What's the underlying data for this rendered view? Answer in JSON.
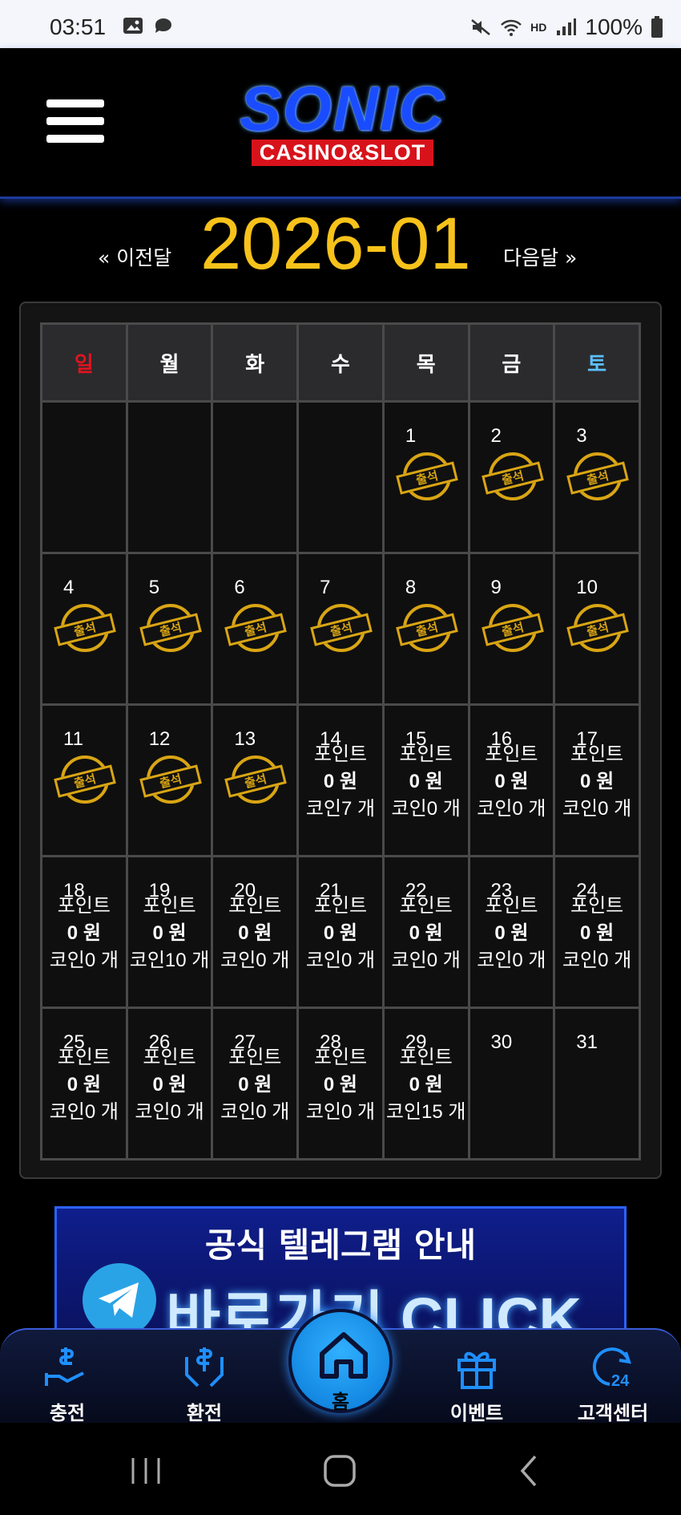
{
  "status_bar": {
    "time": "03:51",
    "battery": "100%",
    "hd_label": "HD"
  },
  "header": {
    "logo_main": "SONIC",
    "logo_sub": "CASINO&SLOT"
  },
  "month_nav": {
    "prev_label": "« 이전달",
    "title": "2026-01",
    "next_label": "다음달 »"
  },
  "weekdays": [
    "일",
    "월",
    "화",
    "수",
    "목",
    "금",
    "토"
  ],
  "stamp_text": "출석",
  "weeks": [
    [
      {
        "day": ""
      },
      {
        "day": ""
      },
      {
        "day": ""
      },
      {
        "day": ""
      },
      {
        "day": "1",
        "stamp": true
      },
      {
        "day": "2",
        "stamp": true
      },
      {
        "day": "3",
        "stamp": true
      }
    ],
    [
      {
        "day": "4",
        "stamp": true
      },
      {
        "day": "5",
        "stamp": true
      },
      {
        "day": "6",
        "stamp": true
      },
      {
        "day": "7",
        "stamp": true
      },
      {
        "day": "8",
        "stamp": true
      },
      {
        "day": "9",
        "stamp": true
      },
      {
        "day": "10",
        "stamp": true
      }
    ],
    [
      {
        "day": "11",
        "stamp": true
      },
      {
        "day": "12",
        "stamp": true
      },
      {
        "day": "13",
        "stamp": true
      },
      {
        "day": "14",
        "point": "포인트",
        "won": "0 원",
        "coin": "코인7 개"
      },
      {
        "day": "15",
        "point": "포인트",
        "won": "0 원",
        "coin": "코인0 개"
      },
      {
        "day": "16",
        "point": "포인트",
        "won": "0 원",
        "coin": "코인0 개"
      },
      {
        "day": "17",
        "point": "포인트",
        "won": "0 원",
        "coin": "코인0 개"
      }
    ],
    [
      {
        "day": "18",
        "point": "포인트",
        "won": "0 원",
        "coin": "코인0 개"
      },
      {
        "day": "19",
        "point": "포인트",
        "won": "0 원",
        "coin": "코인10 개"
      },
      {
        "day": "20",
        "point": "포인트",
        "won": "0 원",
        "coin": "코인0 개"
      },
      {
        "day": "21",
        "point": "포인트",
        "won": "0 원",
        "coin": "코인0 개"
      },
      {
        "day": "22",
        "point": "포인트",
        "won": "0 원",
        "coin": "코인0 개"
      },
      {
        "day": "23",
        "point": "포인트",
        "won": "0 원",
        "coin": "코인0 개"
      },
      {
        "day": "24",
        "point": "포인트",
        "won": "0 원",
        "coin": "코인0 개"
      }
    ],
    [
      {
        "day": "25",
        "point": "포인트",
        "won": "0 원",
        "coin": "코인0 개"
      },
      {
        "day": "26",
        "point": "포인트",
        "won": "0 원",
        "coin": "코인0 개"
      },
      {
        "day": "27",
        "point": "포인트",
        "won": "0 원",
        "coin": "코인0 개"
      },
      {
        "day": "28",
        "point": "포인트",
        "won": "0 원",
        "coin": "코인0 개"
      },
      {
        "day": "29",
        "point": "포인트",
        "won": "0 원",
        "coin": "코인15 개"
      },
      {
        "day": "30"
      },
      {
        "day": "31"
      }
    ]
  ],
  "banner": {
    "line1": "공식 텔레그램 안내",
    "line2": "바로가기 CLICK"
  },
  "bottom_nav": {
    "charge": "충전",
    "exchange": "환전",
    "home": "홈",
    "event": "이벤트",
    "support": "고객센터"
  },
  "colors": {
    "accent_yellow": "#f7c21a",
    "sunday": "#e0141e",
    "saturday": "#5bc0ff",
    "nav_blue": "#1f8fff"
  }
}
